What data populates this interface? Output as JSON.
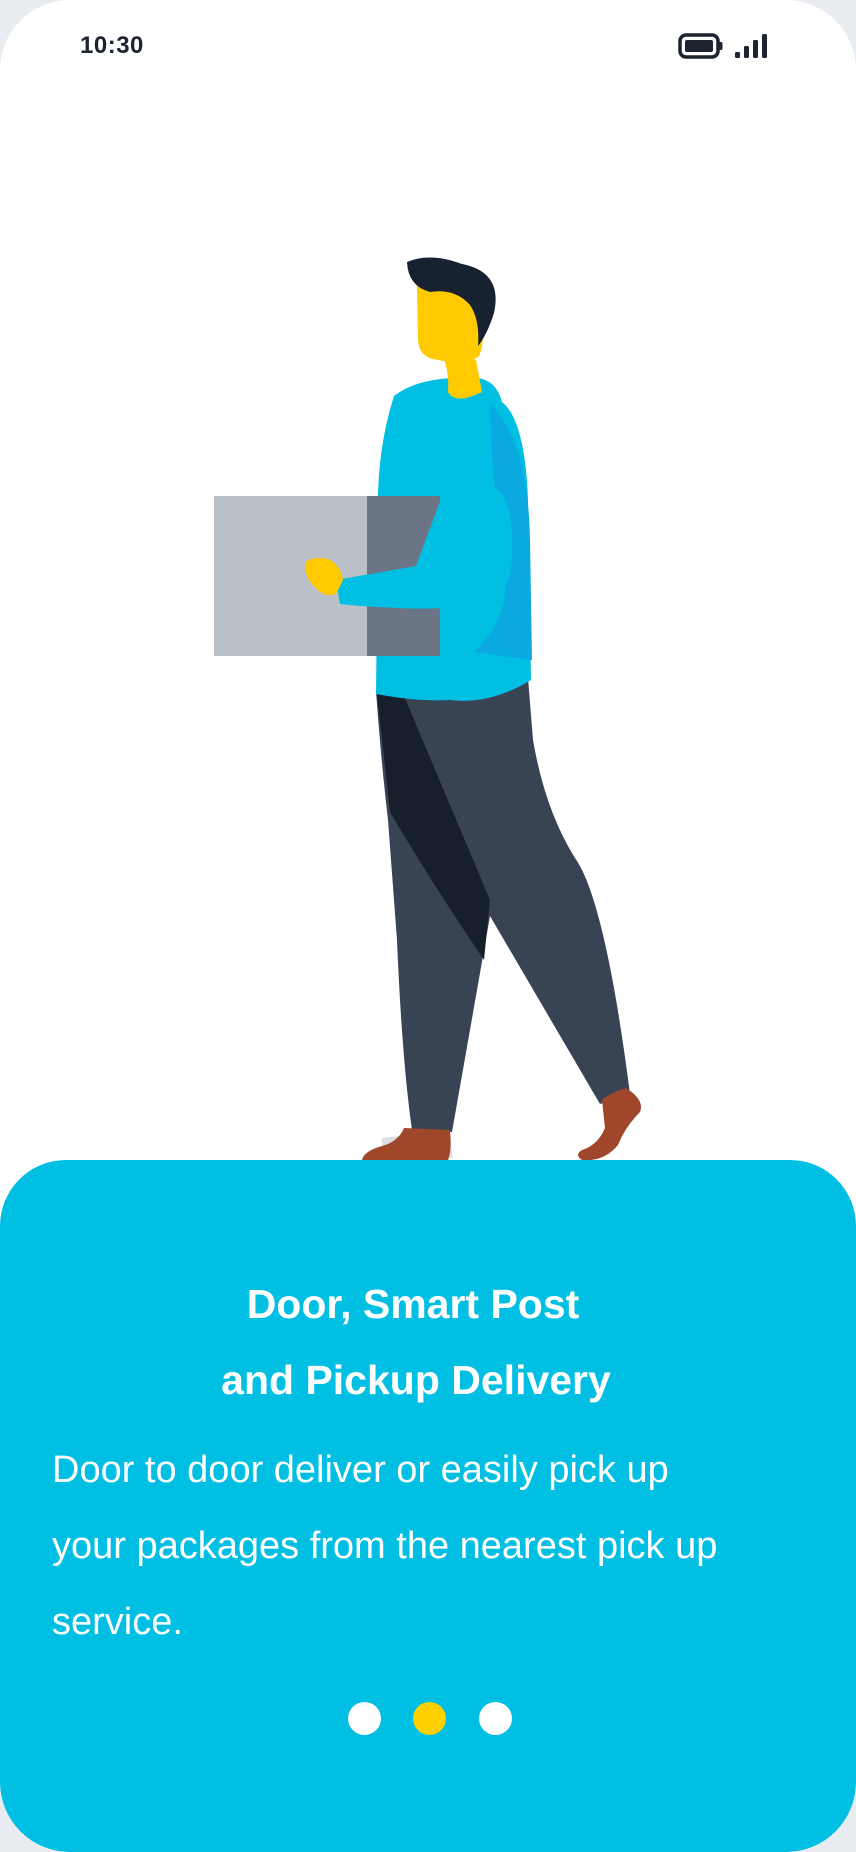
{
  "status_bar": {
    "time": "10:30",
    "icons": [
      "battery-icon",
      "signal-icon"
    ]
  },
  "illustration": {
    "subject": "courier-carrying-box"
  },
  "onboarding": {
    "title_line_1": "Door, Smart Post",
    "title_line_2": "and Pickup Delivery",
    "description_line_1": "Door to door deliver or easily pick up",
    "description_line_2": "your packages from the nearest pick up",
    "description_line_3": "service.",
    "page_count": 3,
    "active_page": 2
  },
  "colors": {
    "accent": "#00bfe2",
    "active_dot": "#ffd100",
    "inactive_dot": "#ffffff",
    "text_dark": "#1c2430"
  }
}
